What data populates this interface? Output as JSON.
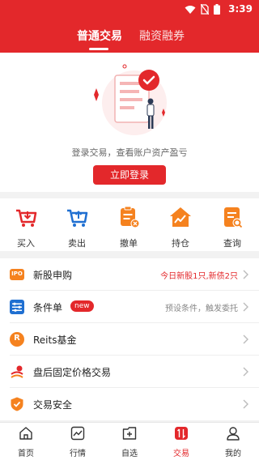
{
  "status": {
    "time": "3:39",
    "icons": [
      "wifi-icon",
      "no-sim-icon",
      "battery-icon"
    ]
  },
  "tabs": [
    {
      "label": "普通交易",
      "active": true
    },
    {
      "label": "融资融券",
      "active": false
    }
  ],
  "login": {
    "hint": "登录交易，查看账户资产盈亏",
    "button": "立即登录"
  },
  "quick_actions": [
    {
      "label": "买入",
      "icon": "cart-buy-icon"
    },
    {
      "label": "卖出",
      "icon": "cart-sell-icon"
    },
    {
      "label": "撤单",
      "icon": "cancel-order-icon"
    },
    {
      "label": "持仓",
      "icon": "position-chart-icon"
    },
    {
      "label": "查询",
      "icon": "query-icon"
    }
  ],
  "menu": [
    {
      "title": "新股申购",
      "icon": "ipo-icon",
      "icon_text": "IPO",
      "right": "今日新股1只,新债2只",
      "right_color": "#e3282b"
    },
    {
      "title": "条件单",
      "icon": "condition-order-icon",
      "badge": "new",
      "right": "预设条件，触发委托",
      "right_color": "#888888"
    },
    {
      "title": "Reits基金",
      "icon": "reits-icon",
      "icon_text": "R",
      "right": ""
    },
    {
      "title": "盘后固定价格交易",
      "icon": "after-hours-icon",
      "right": ""
    },
    {
      "title": "交易安全",
      "icon": "security-shield-icon",
      "right": ""
    }
  ],
  "bottom_nav": [
    {
      "label": "首页",
      "icon": "home-icon",
      "active": false
    },
    {
      "label": "行情",
      "icon": "market-icon",
      "active": false
    },
    {
      "label": "自选",
      "icon": "watchlist-icon",
      "active": false
    },
    {
      "label": "交易",
      "icon": "trade-icon",
      "active": true
    },
    {
      "label": "我的",
      "icon": "profile-icon",
      "active": false
    }
  ],
  "colors": {
    "brand": "#e3282b",
    "orange": "#f5821f",
    "blue": "#1f6fd1"
  }
}
